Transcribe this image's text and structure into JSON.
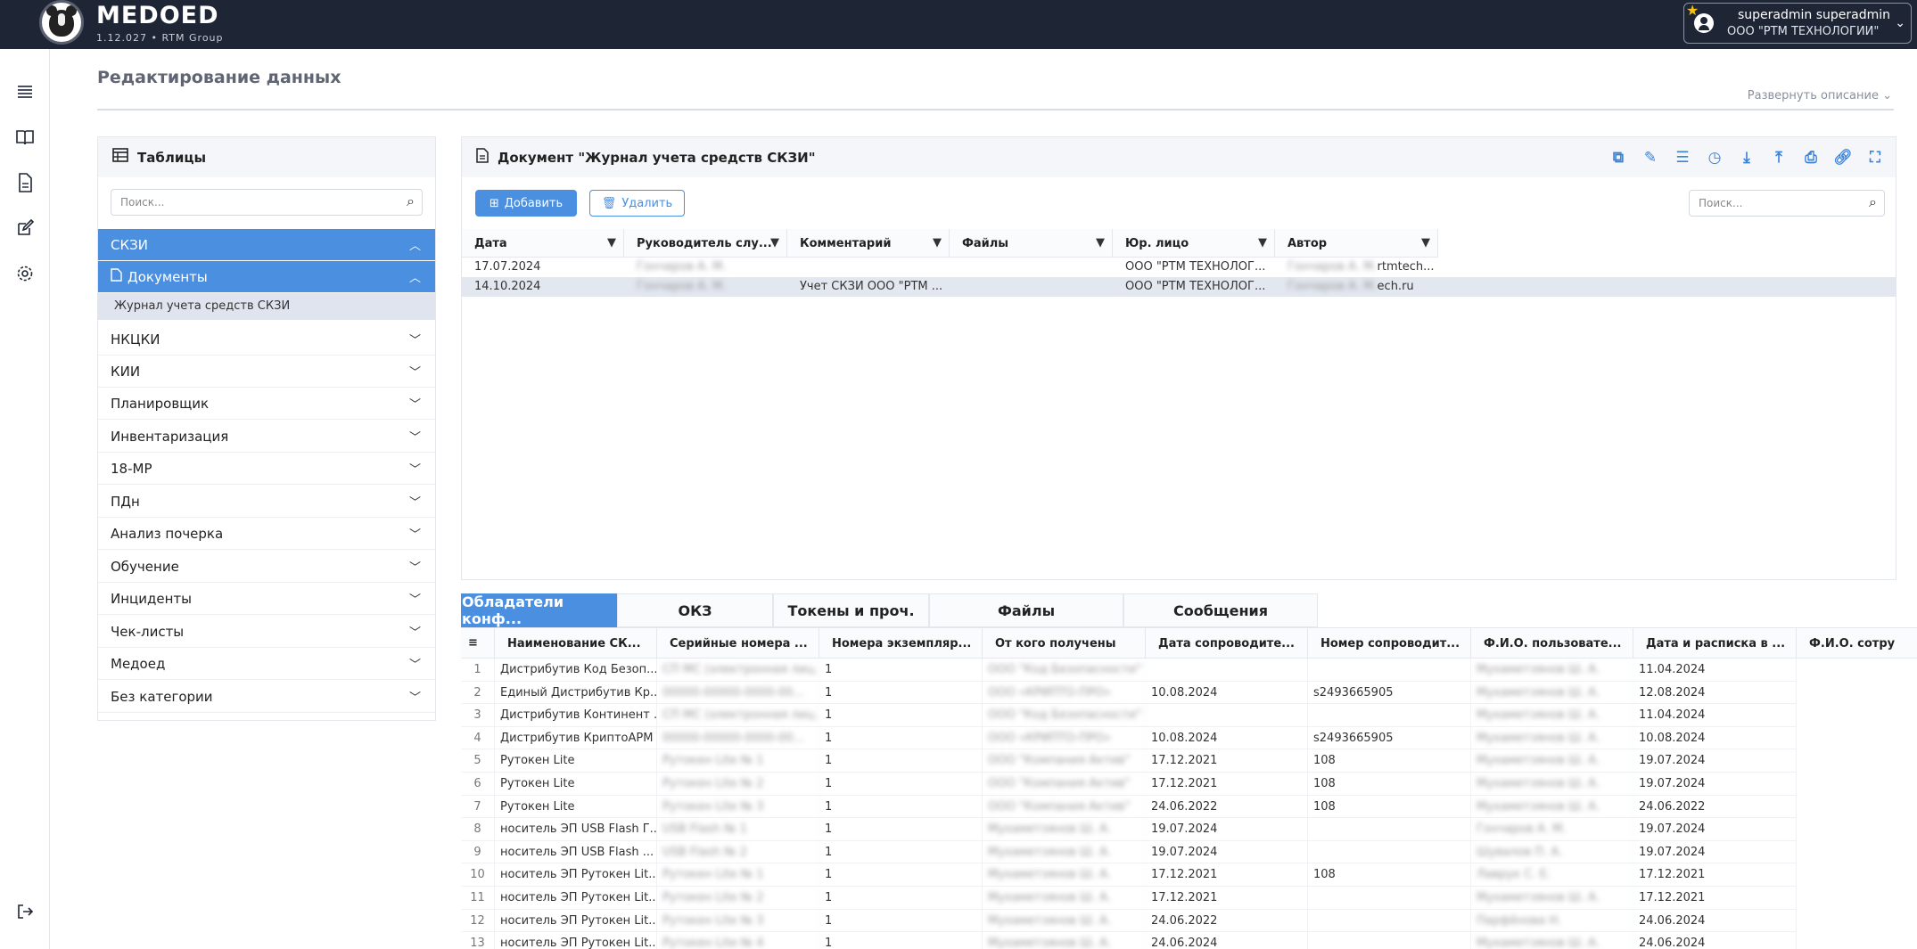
{
  "app": {
    "brand": "MEDOED",
    "version": "1.12.027 • RTM Group",
    "user_name": "superadmin superadmin",
    "user_org": "ООО \"РТМ ТЕХНОЛОГИИ\""
  },
  "page": {
    "title": "Редактирование данных",
    "expand_desc": "Развернуть описание"
  },
  "tables_panel": {
    "title": "Таблицы",
    "search_placeholder": "Поиск...",
    "categories": [
      {
        "label": "СКЗИ"
      },
      {
        "label": "Документы"
      },
      {
        "label": "Журнал учета средств СКЗИ"
      },
      {
        "label": "НКЦКИ"
      },
      {
        "label": "КИИ"
      },
      {
        "label": "Планировщик"
      },
      {
        "label": "Инвентаризация"
      },
      {
        "label": "18-МР"
      },
      {
        "label": "ПДн"
      },
      {
        "label": "Анализ почерка"
      },
      {
        "label": "Обучение"
      },
      {
        "label": "Инциденты"
      },
      {
        "label": "Чек-листы"
      },
      {
        "label": "Медоед"
      },
      {
        "label": "Без категории"
      }
    ]
  },
  "document": {
    "title": "Документ \"Журнал учета средств СКЗИ\"",
    "add_label": "Добавить",
    "delete_label": "Удалить",
    "search_placeholder": "Поиск...",
    "columns": [
      "Дата",
      "Руководитель слу...",
      "Комментарий",
      "Файлы",
      "Юр. лицо",
      "Автор"
    ],
    "rows": [
      {
        "date": "17.07.2024",
        "head": "Гончаров А. М.",
        "comment": "",
        "files": "",
        "entity": "ООО \"РТМ ТЕХНОЛОГ...",
        "author_blur": "Гончаров А. М.",
        "author": "rtmtech..."
      },
      {
        "date": "14.10.2024",
        "head": "Гончаров А. М.",
        "comment": "Учет СКЗИ ООО \"РТМ ...",
        "files": "",
        "entity": "ООО \"РТМ ТЕХНОЛОГ...",
        "author_blur": "Гончаров А. М.",
        "author": "ech.ru"
      }
    ]
  },
  "tabs": [
    {
      "label": "Обладатели конф..."
    },
    {
      "label": "ОКЗ"
    },
    {
      "label": "Токены и проч."
    },
    {
      "label": "Файлы"
    },
    {
      "label": "Сообщения"
    }
  ],
  "bottom_grid": {
    "columns": [
      "Наименование СК...",
      "Серийные номера ...",
      "Номера экземпляр...",
      "От кого получены",
      "Дата сопроводите...",
      "Номер сопроводит...",
      "Ф.И.О. пользовате...",
      "Дата и расписка в ...",
      "Ф.И.О. сотру"
    ],
    "rows": [
      {
        "n": "1",
        "name": "Дистрибутив  Код Безоп...",
        "serial": "СП МС (электронная лиц...",
        "copies": "1",
        "from": "ООО \"Код Безопасности\"",
        "date": "",
        "doc": "",
        "user": "Мухаметзянов Ш. А.",
        "receipt": "11.04.2024"
      },
      {
        "n": "2",
        "name": "Единый Дистрибутив Кр...",
        "serial": "00000-00000-0000-00...",
        "copies": "1",
        "from": "ООО «КРИПТО-ПРО»",
        "date": "10.08.2024",
        "doc": "s2493665905",
        "user": "Мухаметзянов Ш. А.",
        "receipt": "12.08.2024"
      },
      {
        "n": "3",
        "name": "Дистрибутив  Континент ...",
        "serial": "СП МС (электронная лиц...",
        "copies": "1",
        "from": "ООО \"Код Безопасности\"",
        "date": "",
        "doc": "",
        "user": "Мухаметзянов Ш. А.",
        "receipt": "11.04.2024"
      },
      {
        "n": "4",
        "name": "Дистрибутив КриптоАРМ",
        "serial": "00000-00000-0000-00...",
        "copies": "1",
        "from": "ООО «КРИПТО-ПРО»",
        "date": "10.08.2024",
        "doc": "s2493665905",
        "user": "Мухаметзянов Ш. А.",
        "receipt": "10.08.2024"
      },
      {
        "n": "5",
        "name": "Рутокен Lite",
        "serial": "Рутокен Lite № 1",
        "copies": "1",
        "from": "ООО \"Компания Актив\"",
        "date": "17.12.2021",
        "doc": "108",
        "user": "Мухаметзянов Ш. А.",
        "receipt": "19.07.2024"
      },
      {
        "n": "6",
        "name": "Рутокен Lite",
        "serial": "Рутокен Lite № 2",
        "copies": "1",
        "from": "ООО \"Компания Актив\"",
        "date": "17.12.2021",
        "doc": "108",
        "user": "Мухаметзянов Ш. А.",
        "receipt": "19.07.2024"
      },
      {
        "n": "7",
        "name": "Рутокен Lite",
        "serial": "Рутокен Lite № 3",
        "copies": "1",
        "from": "ООО \"Компания Актив\"",
        "date": "24.06.2022",
        "doc": "108",
        "user": "Мухаметзянов Ш. А.",
        "receipt": "24.06.2022"
      },
      {
        "n": "8",
        "name": "носитель ЭП USB Flash  Г...",
        "serial": "USB Flash № 1",
        "copies": "1",
        "from": "Мухаметзянов Ш. А.",
        "date": "19.07.2024",
        "doc": "",
        "user": "Гончаров А. М.",
        "receipt": "19.07.2024"
      },
      {
        "n": "9",
        "name": "носитель ЭП USB Flash ...",
        "serial": "USB Flash № 2",
        "copies": "1",
        "from": "Мухаметзянов Ш. А.",
        "date": "19.07.2024",
        "doc": "",
        "user": "Шувалов П. А.",
        "receipt": "19.07.2024"
      },
      {
        "n": "10",
        "name": "носитель ЭП Рутокен Lit...",
        "serial": "Рутокен Lite № 1",
        "copies": "1",
        "from": "Мухаметзянов Ш. А.",
        "date": "17.12.2021",
        "doc": "108",
        "user": "Лаврук С. Е.",
        "receipt": "17.12.2021"
      },
      {
        "n": "11",
        "name": "носитель ЭП Рутокен Lit...",
        "serial": "Рутокен Lite № 2",
        "copies": "1",
        "from": "Мухаметзянов Ш. А.",
        "date": "17.12.2021",
        "doc": "",
        "user": "Мухаметзянов Ш. А.",
        "receipt": "17.12.2021"
      },
      {
        "n": "12",
        "name": "носитель ЭП Рутокен Lit...",
        "serial": "Рутокен Lite № 3",
        "copies": "1",
        "from": "Мухаметзянов Ш. А.",
        "date": "24.06.2022",
        "doc": "",
        "user": "Парфёнова Н.",
        "receipt": "24.06.2024"
      },
      {
        "n": "13",
        "name": "носитель ЭП Рутокен Lit...",
        "serial": "Рутокен Lite № 4",
        "copies": "1",
        "from": "Мухаметзянов Ш. А.",
        "date": "24.06.2024",
        "doc": "",
        "user": "Мухаметзянов Ш. А.",
        "receipt": "24.06.2024"
      }
    ]
  },
  "colors": {
    "topbar": "#1e2535",
    "accent": "#4a8fe0",
    "selected_row": "#e3e7f0"
  },
  "icons": [
    "menu-icon",
    "book-icon",
    "document-icon",
    "edit-icon",
    "gear-icon",
    "logout-icon",
    "copy-icon",
    "pencil-icon",
    "list-icon",
    "clock-icon",
    "download-icon",
    "upload-icon",
    "print-icon",
    "link-icon",
    "fullscreen-icon",
    "filter-icon",
    "search-icon",
    "chevron-down-icon",
    "chevron-up-icon",
    "table-icon",
    "star-icon",
    "user-avatar-icon"
  ]
}
